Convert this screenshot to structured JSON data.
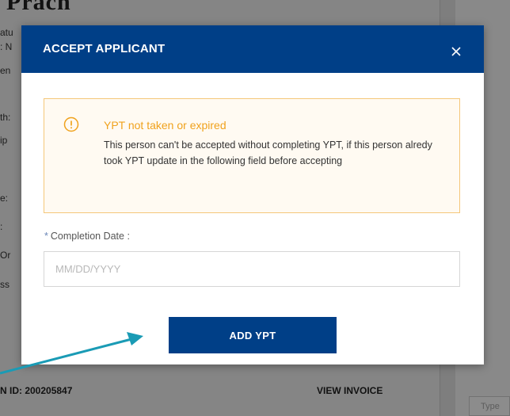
{
  "background": {
    "title_fragment": "Prach",
    "side_labels": [
      "atu",
      ": N",
      "en",
      "th:",
      "ip",
      "e:",
      ":",
      "Or",
      "ss"
    ],
    "footer_id": "N ID: 200205847",
    "footer_invoice": "VIEW INVOICE",
    "type_placeholder": "Type"
  },
  "modal": {
    "title": "ACCEPT APPLICANT",
    "close_icon": "close-icon",
    "alert": {
      "icon": "warning-circle-icon",
      "heading": "YPT not taken or expired",
      "body": "This person can't be accepted without completing YPT, if this person alredy took YPT update in the following field before accepting"
    },
    "field": {
      "required_mark": "*",
      "label": "Completion Date :",
      "placeholder": "MM/DD/YYYY",
      "value": ""
    },
    "submit_label": "ADD YPT"
  },
  "annotation": {
    "arrow_color": "#1a9bb5"
  },
  "colors": {
    "header": "#003f87",
    "warning": "#f0a21d",
    "warning_border": "#f5c77a"
  }
}
